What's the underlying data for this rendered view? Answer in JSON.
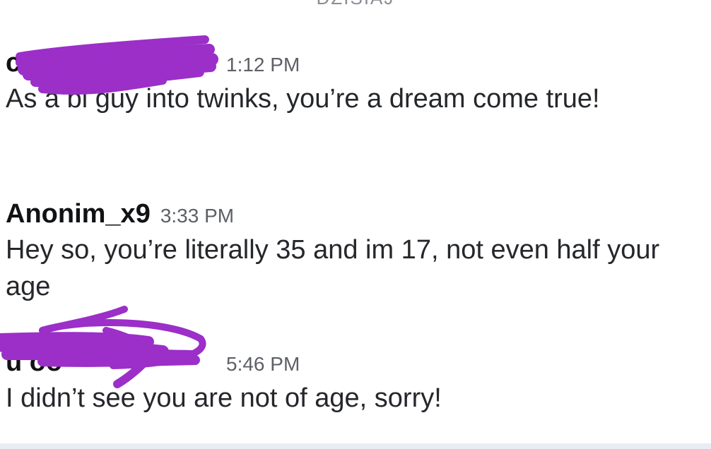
{
  "day_divider": "DZISIAJ",
  "messages": [
    {
      "sender": "c                    oo",
      "time": "1:12 PM",
      "text": "As a bi guy into twinks, you’re a dream come true!"
    },
    {
      "sender": "Anonim_x9",
      "time": "3:33 PM",
      "text": "Hey so, you’re literally 35 and im 17, not even half your age"
    },
    {
      "sender": "u                   oo",
      "time": "5:46 PM",
      "text": "I didn’t see you are not of age, sorry!"
    }
  ],
  "colors": {
    "redaction": "#9b2fc8",
    "timestamp": "#5d6066",
    "text": "#25272b"
  }
}
